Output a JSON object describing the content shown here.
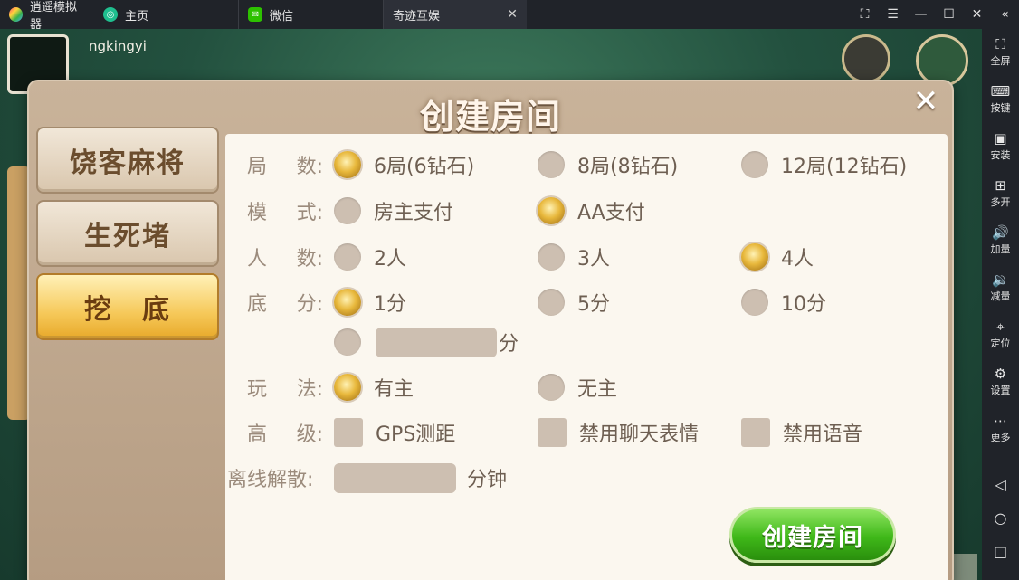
{
  "emulator": {
    "app_name": "逍遥模拟器",
    "tabs": [
      {
        "label": "主页"
      },
      {
        "label": "微信"
      },
      {
        "label": "奇迹互娱",
        "close": "✕"
      }
    ],
    "window_controls": [
      "⛶",
      "☰",
      "—",
      "☐",
      "✕",
      "«"
    ],
    "sidebar": [
      {
        "icon": "⛶",
        "label": "全屏"
      },
      {
        "icon": "⌨",
        "label": "按键"
      },
      {
        "icon": "▣",
        "label": "安装"
      },
      {
        "icon": "⊞",
        "label": "多开"
      },
      {
        "icon": "🔊",
        "label": "加量"
      },
      {
        "icon": "🔉",
        "label": "减量"
      },
      {
        "icon": "⌖",
        "label": "定位"
      },
      {
        "icon": "⚙",
        "label": "设置"
      },
      {
        "icon": "⋯",
        "label": "更多"
      }
    ],
    "nav": [
      "◁",
      "○",
      "□"
    ]
  },
  "game": {
    "username": "ngkingyi"
  },
  "dialog": {
    "title": "创建房间",
    "close": "✕",
    "modes": [
      "饶客麻将",
      "生死堵",
      "挖　底"
    ],
    "active_mode": 2,
    "rows": {
      "rounds": {
        "label": [
          "局",
          "数:"
        ],
        "options": [
          "6局(6钻石)",
          "8局(8钻石)",
          "12局(12钻石)"
        ],
        "selected": 0
      },
      "mode": {
        "label": [
          "模",
          "式:"
        ],
        "options": [
          "房主支付",
          "AA支付"
        ],
        "selected": 1
      },
      "players": {
        "label": [
          "人",
          "数:"
        ],
        "options": [
          "2人",
          "3人",
          "4人"
        ],
        "selected": 2
      },
      "base": {
        "label": [
          "底",
          "分:"
        ],
        "options": [
          "1分",
          "5分",
          "10分"
        ],
        "selected": 0,
        "custom_unit": "分"
      },
      "play": {
        "label": [
          "玩",
          "法:"
        ],
        "options": [
          "有主",
          "无主"
        ],
        "selected": 0
      },
      "advanced": {
        "label": [
          "高",
          "级:"
        ],
        "options": [
          "GPS测距",
          "禁用聊天表情",
          "禁用语音"
        ]
      },
      "dissolve": {
        "label": "离线解散:",
        "unit": "分钟"
      }
    },
    "create_button": "创建房间"
  }
}
